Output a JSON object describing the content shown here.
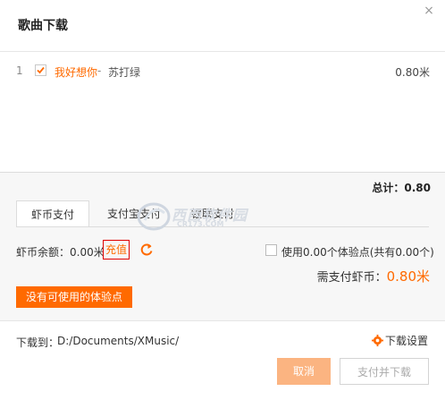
{
  "dialog": {
    "title": "歌曲下载",
    "close_label": "×"
  },
  "songs": [
    {
      "index": "1",
      "checked": true,
      "title": "我好想你",
      "separator": " - ",
      "artist": "苏打绿",
      "price": "0.80米"
    }
  ],
  "summary": {
    "total": "总计：0.80"
  },
  "payment_tabs": [
    {
      "label": "虾币支付",
      "active": true
    },
    {
      "label": "支付宝支付",
      "active": false
    },
    {
      "label": "银联支付",
      "active": false
    }
  ],
  "shrimp_pay": {
    "balance_label": "虾币余额：0.00米",
    "recharge_label": "充值",
    "use_exp_label": "使用0.00个体验点(共有0.00个)",
    "need_pay_label": "需支付虾币：",
    "need_pay_amount": "0.80米",
    "no_exp_button": "没有可使用的体验点"
  },
  "download": {
    "label": "下载到：",
    "path": "D:/Documents/XMusic/",
    "settings_label": "下载设置"
  },
  "buttons": {
    "cancel": "取消",
    "pay_download": "支付并下载"
  },
  "watermark": {
    "text": "西西软件园",
    "sub": "CR173.COM"
  },
  "colors": {
    "accent": "#ff6a00",
    "cancel_bg": "#fbb481",
    "recharge_border": "#e00000",
    "pay_area_bg": "#f7f7f7"
  },
  "icons": [
    "close-icon",
    "check-icon",
    "refresh-icon",
    "gear-icon"
  ]
}
